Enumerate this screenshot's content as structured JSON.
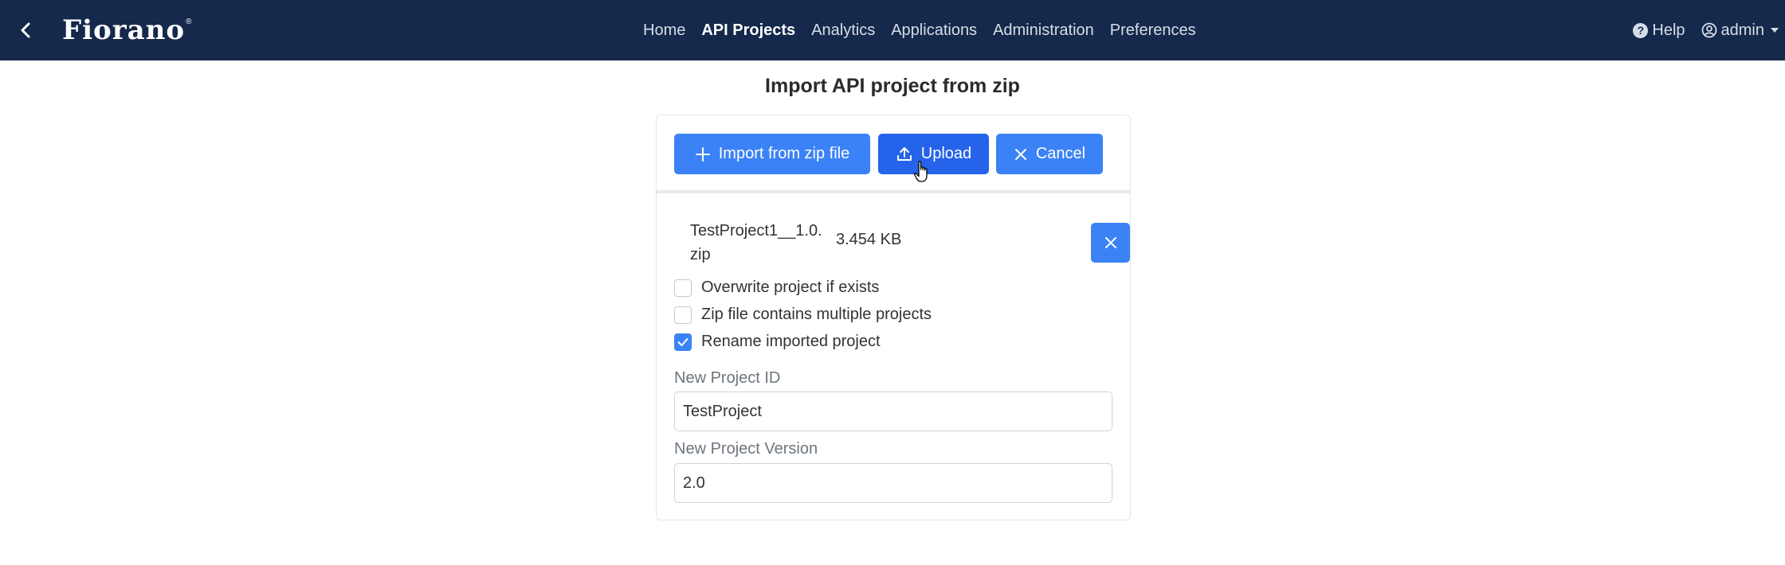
{
  "nav": {
    "logo": "Fiorano",
    "logo_mark": "®",
    "items": [
      {
        "label": "Home",
        "active": false
      },
      {
        "label": "API Projects",
        "active": true
      },
      {
        "label": "Analytics",
        "active": false
      },
      {
        "label": "Applications",
        "active": false
      },
      {
        "label": "Administration",
        "active": false
      },
      {
        "label": "Preferences",
        "active": false
      }
    ],
    "help_label": "Help",
    "user_label": "admin"
  },
  "page": {
    "title": "Import API project from zip"
  },
  "toolbar": {
    "import_label": "Import from zip file",
    "upload_label": "Upload",
    "cancel_label": "Cancel"
  },
  "file": {
    "name": "TestProject1__1.0.zip",
    "size": "3.454 KB"
  },
  "options": [
    {
      "label": "Overwrite project if exists",
      "checked": false
    },
    {
      "label": "Zip file contains multiple projects",
      "checked": false
    },
    {
      "label": "Rename imported project",
      "checked": true
    }
  ],
  "fields": {
    "project_id_label": "New Project ID",
    "project_id_value": "TestProject",
    "project_version_label": "New Project Version",
    "project_version_value": "2.0"
  },
  "colors": {
    "nav_bg": "#14294b",
    "primary": "#3b82f6",
    "primary_hover": "#2563eb"
  }
}
